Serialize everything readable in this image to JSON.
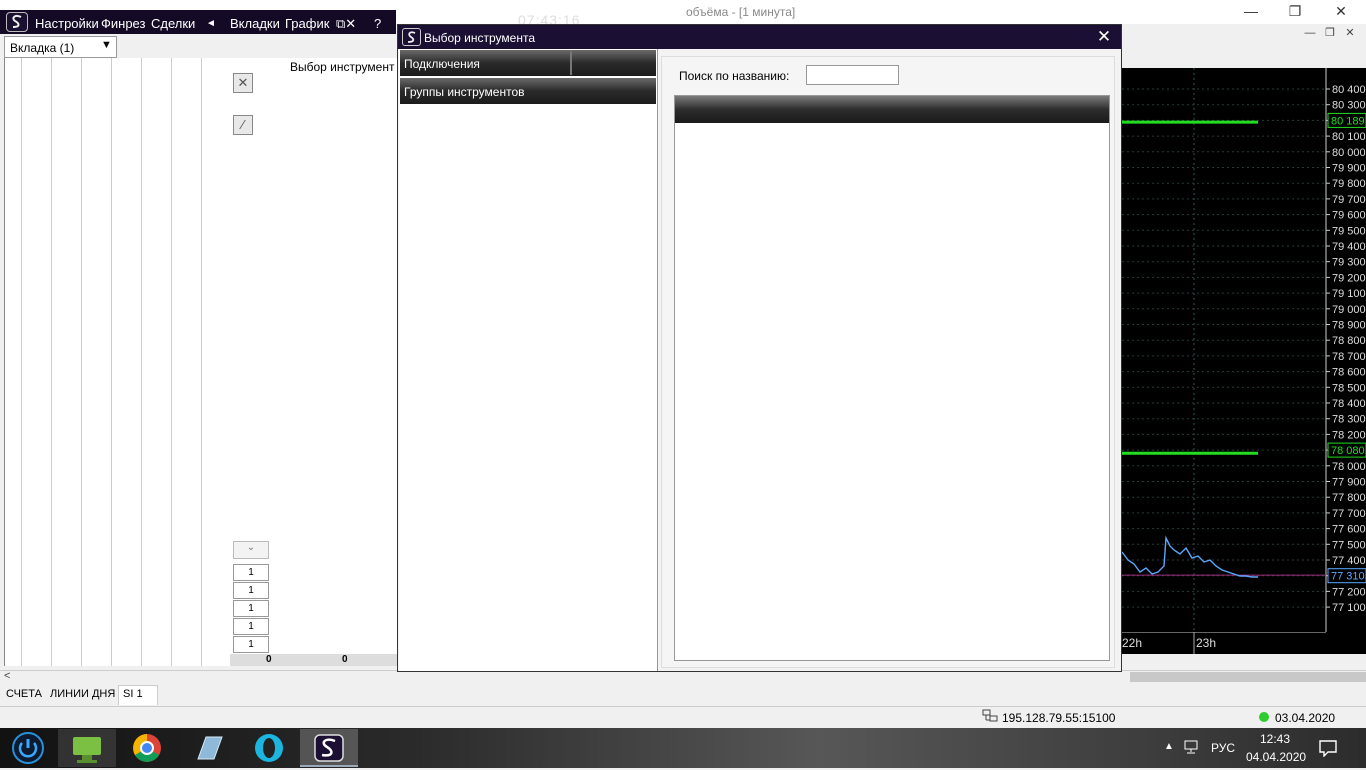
{
  "window": {
    "bg_title": "объёма - [1 минута]",
    "minimize": "—",
    "restore": "❐",
    "close": "✕"
  },
  "app_menu": {
    "items": [
      "Настройки",
      "Финрез",
      "Сделки",
      "◄",
      "Вкладки",
      "График",
      "⧉✕",
      "?"
    ],
    "clock": "07:43:16",
    "min": "—",
    "max": "▀",
    "close": "✕"
  },
  "left_panel": {
    "tab_selector": "Вкладка (1)",
    "strip_title": "Выбор инструмент",
    "qty_values": [
      "1",
      "1",
      "1",
      "1",
      "1"
    ],
    "totals": [
      "0",
      "0"
    ]
  },
  "dialog": {
    "title": "Выбор инструмента",
    "connections_header": "Подключения",
    "groups_header": "Группы инструментов",
    "search_label": "Поиск по названию:",
    "search_value": ""
  },
  "chart_data": {
    "type": "line",
    "y_ticks": [
      "80 400",
      "80 300",
      "80 189",
      "80 100",
      "80 000",
      "79 900",
      "79 800",
      "79 700",
      "79 600",
      "79 500",
      "79 400",
      "79 300",
      "79 200",
      "79 100",
      "79 000",
      "78 900",
      "78 800",
      "78 700",
      "78 600",
      "78 500",
      "78 400",
      "78 300",
      "78 200",
      "78 080",
      "78 000",
      "77 900",
      "77 800",
      "77 700",
      "77 600",
      "77 500",
      "77 400",
      "77 310",
      "77 200",
      "77 100"
    ],
    "x_ticks": [
      "22h",
      "23h"
    ],
    "levels": [
      80189,
      78080
    ],
    "current_price": 77310,
    "level_color": "#22dd22",
    "price_color": "#5aa9ff"
  },
  "bottom_tabs": [
    "СЧЕТА",
    "ЛИНИИ ДНЯ",
    "SI 1"
  ],
  "status": {
    "ip": "195.128.79.55:15100",
    "date": "03.04.2020"
  },
  "taskbar": {
    "time": "12:43",
    "date": "04.04.2020",
    "lang": "РУС"
  }
}
